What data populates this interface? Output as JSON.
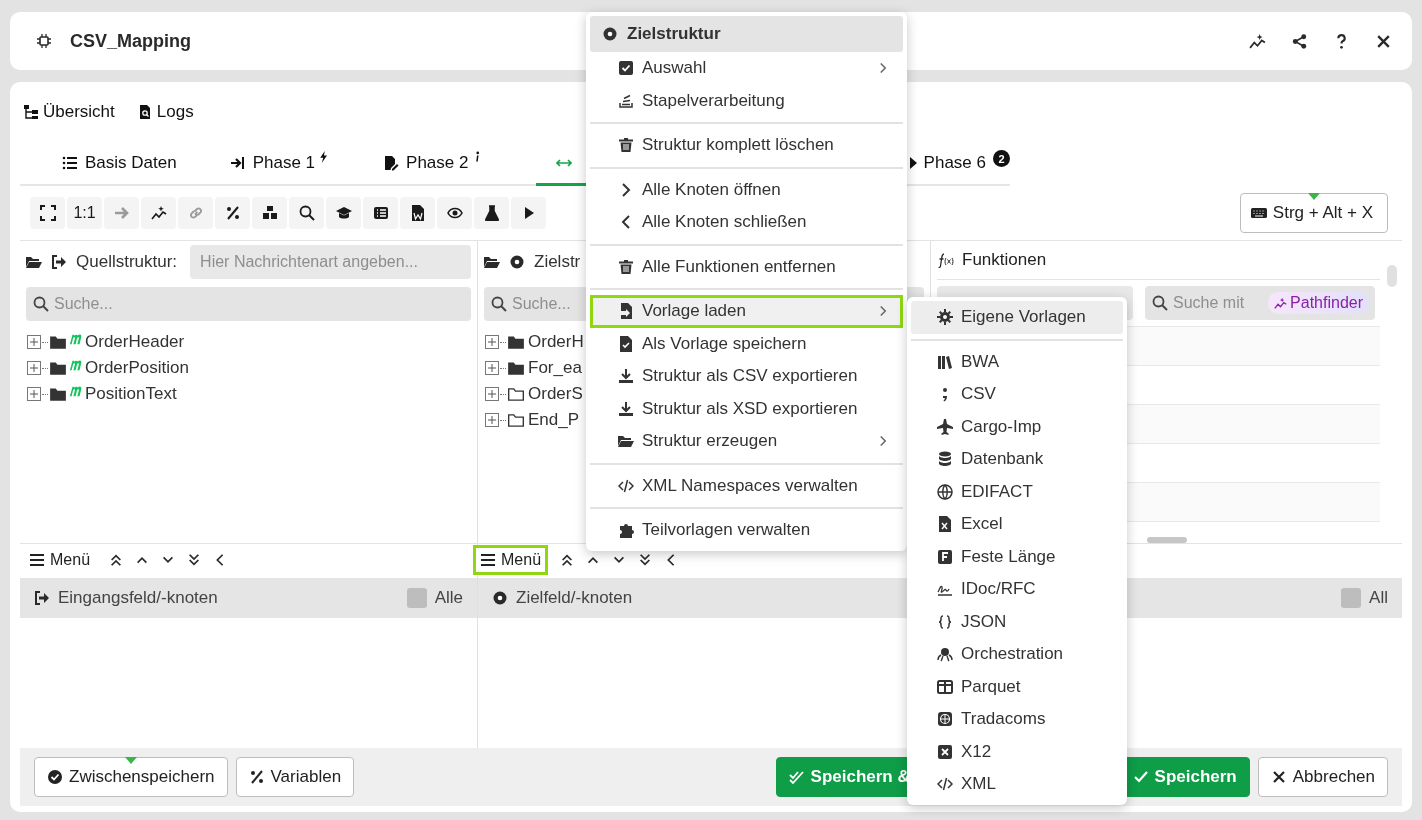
{
  "header": {
    "title": "CSV_Mapping"
  },
  "nav_links": [
    {
      "label": "Übersicht"
    },
    {
      "label": "Logs"
    }
  ],
  "tabs": [
    {
      "label": "Basis Daten",
      "selected": false
    },
    {
      "label": "Phase 1",
      "selected": false
    },
    {
      "label": "Phase 2",
      "selected": false
    },
    {
      "selected": true
    },
    {
      "label": "Phase 6",
      "badge": "2",
      "selected": false
    }
  ],
  "toolbar": {
    "buttons": [
      {
        "kind": "icon",
        "disabled": false
      },
      {
        "kind": "text",
        "label": "1:1",
        "disabled": false
      },
      {
        "kind": "icon",
        "disabled": true
      },
      {
        "kind": "icon",
        "disabled": false
      },
      {
        "kind": "icon",
        "disabled": true
      },
      {
        "kind": "icon",
        "disabled": false
      },
      {
        "kind": "icon",
        "disabled": false
      },
      {
        "kind": "icon",
        "disabled": false
      },
      {
        "kind": "icon",
        "disabled": false
      },
      {
        "kind": "icon",
        "disabled": false
      },
      {
        "kind": "icon",
        "disabled": false
      },
      {
        "kind": "icon",
        "disabled": false
      },
      {
        "kind": "icon",
        "disabled": false
      },
      {
        "kind": "icon",
        "disabled": false
      }
    ],
    "shortcut": "Strg + Alt + X"
  },
  "source_panel": {
    "label": "Quellstruktur:",
    "type_placeholder": "Hier Nachrichtenart angeben...",
    "search_placeholder": "Suche...",
    "tree": [
      {
        "label": "OrderHeader",
        "filled": true,
        "mapped": true
      },
      {
        "label": "OrderPosition",
        "filled": true,
        "mapped": true
      },
      {
        "label": "PositionText",
        "filled": true,
        "mapped": true
      }
    ]
  },
  "target_panel": {
    "label": "Zielstr",
    "search_placeholder": "Suche...",
    "tree": [
      {
        "label": "OrderH",
        "filled": true,
        "mapped": false
      },
      {
        "label": "For_ea",
        "filled": true,
        "mapped": false
      },
      {
        "label": "OrderS",
        "filled": false,
        "mapped": false
      },
      {
        "label": "End_P",
        "filled": false,
        "mapped": false
      }
    ]
  },
  "functions_panel": {
    "title": "Funktionen",
    "search_placeholder": "Suche mit",
    "pathfinder": "Pathfinder"
  },
  "lower_left": {
    "menu_label": "Menü",
    "focused": false,
    "column": "Eingangsfeld/-knoten",
    "all_label": "Alle",
    "all_checked": false
  },
  "lower_right": {
    "menu_label": "Menü",
    "focused": true,
    "column": "Zielfeld/-knoten",
    "all_label": "All",
    "all_checked": false
  },
  "footer": {
    "left_buttons": [
      {
        "label": "Zwischenspeichern",
        "marked": true
      },
      {
        "label": "Variablen",
        "marked": false
      }
    ],
    "right_buttons": [
      {
        "label": "Speichern &",
        "kind": "primary"
      },
      {
        "label": "Speichern",
        "kind": "primary"
      },
      {
        "label": "Abbrechen",
        "kind": "secondary"
      }
    ]
  },
  "context_menu": {
    "items": [
      {
        "kind": "header",
        "label": "Zielstruktur"
      },
      {
        "kind": "item",
        "label": "Auswahl",
        "submenu": true,
        "highlighted": false
      },
      {
        "kind": "item",
        "label": "Stapelverarbeitung",
        "submenu": false,
        "highlighted": false
      },
      {
        "kind": "separator"
      },
      {
        "kind": "item",
        "label": "Struktur komplett löschen",
        "submenu": false,
        "highlighted": false
      },
      {
        "kind": "separator"
      },
      {
        "kind": "item",
        "label": "Alle Knoten öffnen",
        "submenu": false,
        "highlighted": false
      },
      {
        "kind": "item",
        "label": "Alle Knoten schließen",
        "submenu": false,
        "highlighted": false
      },
      {
        "kind": "separator"
      },
      {
        "kind": "item",
        "label": "Alle Funktionen entfernen",
        "submenu": false,
        "highlighted": false
      },
      {
        "kind": "separator"
      },
      {
        "kind": "item",
        "label": "Vorlage laden",
        "submenu": true,
        "highlighted": true
      },
      {
        "kind": "item",
        "label": "Als Vorlage speichern",
        "submenu": false,
        "highlighted": false
      },
      {
        "kind": "item",
        "label": "Struktur als CSV exportieren",
        "submenu": false,
        "highlighted": false
      },
      {
        "kind": "item",
        "label": "Struktur als XSD exportieren",
        "submenu": false,
        "highlighted": false
      },
      {
        "kind": "item",
        "label": "Struktur erzeugen",
        "submenu": true,
        "highlighted": false
      },
      {
        "kind": "separator"
      },
      {
        "kind": "item",
        "label": "XML Namespaces verwalten",
        "submenu": false,
        "highlighted": false
      },
      {
        "kind": "separator"
      },
      {
        "kind": "item",
        "label": "Teilvorlagen verwalten",
        "submenu": false,
        "highlighted": false
      }
    ]
  },
  "submenu": {
    "items": [
      {
        "kind": "item",
        "label": "Eigene Vorlagen",
        "highlighted": true
      },
      {
        "kind": "separator"
      },
      {
        "kind": "item",
        "label": "BWA",
        "highlighted": false
      },
      {
        "kind": "item",
        "label": "CSV",
        "highlighted": false
      },
      {
        "kind": "item",
        "label": "Cargo-Imp",
        "highlighted": false
      },
      {
        "kind": "item",
        "label": "Datenbank",
        "highlighted": false
      },
      {
        "kind": "item",
        "label": "EDIFACT",
        "highlighted": false
      },
      {
        "kind": "item",
        "label": "Excel",
        "highlighted": false
      },
      {
        "kind": "item",
        "label": "Feste Länge",
        "highlighted": false
      },
      {
        "kind": "item",
        "label": "IDoc/RFC",
        "highlighted": false
      },
      {
        "kind": "item",
        "label": "JSON",
        "highlighted": false
      },
      {
        "kind": "item",
        "label": "Orchestration",
        "highlighted": false
      },
      {
        "kind": "item",
        "label": "Parquet",
        "highlighted": false
      },
      {
        "kind": "item",
        "label": "Tradacoms",
        "highlighted": false
      },
      {
        "kind": "item",
        "label": "X12",
        "highlighted": false
      },
      {
        "kind": "item",
        "label": "XML",
        "highlighted": false
      }
    ]
  }
}
